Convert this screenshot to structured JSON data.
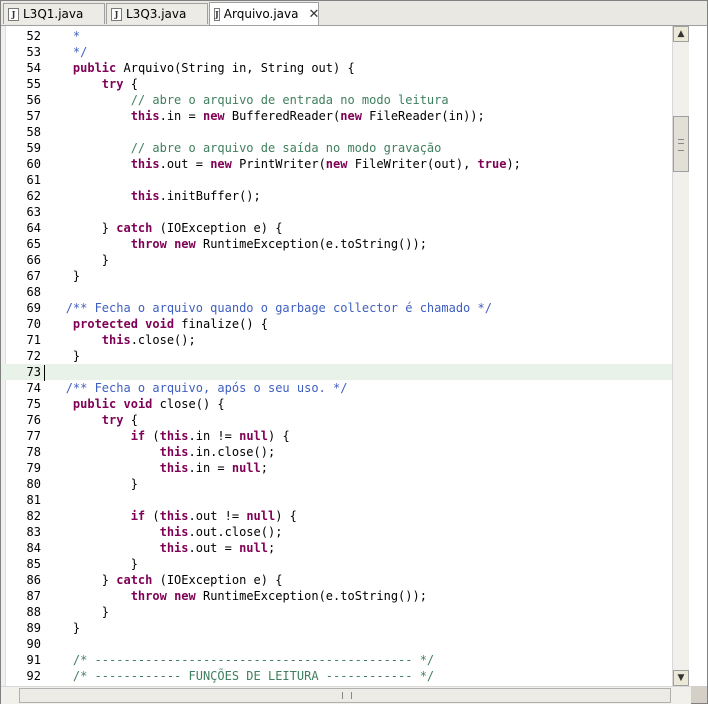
{
  "tabs": [
    {
      "label": "L3Q1.java",
      "active": false
    },
    {
      "label": "L3Q3.java",
      "active": false
    },
    {
      "label": "Arquivo.java",
      "active": true
    }
  ],
  "icons": {
    "file": "java-file-icon",
    "close": "close-icon",
    "up": "arrow-up-icon",
    "down": "arrow-down-icon"
  },
  "editor": {
    "current_line": 73,
    "lines": [
      {
        "n": "52",
        "segs": [
          {
            "t": "    ",
            "c": ""
          },
          {
            "t": "*",
            "c": "jd"
          }
        ]
      },
      {
        "n": "53",
        "segs": [
          {
            "t": "    ",
            "c": ""
          },
          {
            "t": "*/",
            "c": "jd"
          }
        ]
      },
      {
        "n": "54",
        "segs": [
          {
            "t": "    ",
            "c": ""
          },
          {
            "t": "public",
            "c": "kw"
          },
          {
            "t": " Arquivo(String in, String out) {",
            "c": ""
          }
        ]
      },
      {
        "n": "55",
        "segs": [
          {
            "t": "        ",
            "c": ""
          },
          {
            "t": "try",
            "c": "kw"
          },
          {
            "t": " {",
            "c": ""
          }
        ]
      },
      {
        "n": "56",
        "segs": [
          {
            "t": "            ",
            "c": ""
          },
          {
            "t": "// abre o arquivo de entrada no modo leitura",
            "c": "cm"
          }
        ]
      },
      {
        "n": "57",
        "segs": [
          {
            "t": "            ",
            "c": ""
          },
          {
            "t": "this",
            "c": "kw"
          },
          {
            "t": ".in = ",
            "c": ""
          },
          {
            "t": "new",
            "c": "kw"
          },
          {
            "t": " BufferedReader(",
            "c": ""
          },
          {
            "t": "new",
            "c": "kw"
          },
          {
            "t": " FileReader(in));",
            "c": ""
          }
        ]
      },
      {
        "n": "58",
        "segs": []
      },
      {
        "n": "59",
        "segs": [
          {
            "t": "            ",
            "c": ""
          },
          {
            "t": "// abre o arquivo de saída no modo gravação",
            "c": "cm"
          }
        ]
      },
      {
        "n": "60",
        "segs": [
          {
            "t": "            ",
            "c": ""
          },
          {
            "t": "this",
            "c": "kw"
          },
          {
            "t": ".out = ",
            "c": ""
          },
          {
            "t": "new",
            "c": "kw"
          },
          {
            "t": " PrintWriter(",
            "c": ""
          },
          {
            "t": "new",
            "c": "kw"
          },
          {
            "t": " FileWriter(out), ",
            "c": ""
          },
          {
            "t": "true",
            "c": "kw"
          },
          {
            "t": ");",
            "c": ""
          }
        ]
      },
      {
        "n": "61",
        "segs": []
      },
      {
        "n": "62",
        "segs": [
          {
            "t": "            ",
            "c": ""
          },
          {
            "t": "this",
            "c": "kw"
          },
          {
            "t": ".initBuffer();",
            "c": ""
          }
        ]
      },
      {
        "n": "63",
        "segs": []
      },
      {
        "n": "64",
        "segs": [
          {
            "t": "        } ",
            "c": ""
          },
          {
            "t": "catch",
            "c": "kw"
          },
          {
            "t": " (IOException e) {",
            "c": ""
          }
        ]
      },
      {
        "n": "65",
        "segs": [
          {
            "t": "            ",
            "c": ""
          },
          {
            "t": "throw",
            "c": "kw"
          },
          {
            "t": " ",
            "c": ""
          },
          {
            "t": "new",
            "c": "kw"
          },
          {
            "t": " RuntimeException(e.toString());",
            "c": ""
          }
        ]
      },
      {
        "n": "66",
        "segs": [
          {
            "t": "        }",
            "c": ""
          }
        ]
      },
      {
        "n": "67",
        "segs": [
          {
            "t": "    }",
            "c": ""
          }
        ]
      },
      {
        "n": "68",
        "segs": []
      },
      {
        "n": "69",
        "segs": [
          {
            "t": "   ",
            "c": ""
          },
          {
            "t": "/** Fecha o arquivo quando o garbage collector é chamado */",
            "c": "jd"
          }
        ]
      },
      {
        "n": "70",
        "segs": [
          {
            "t": "    ",
            "c": ""
          },
          {
            "t": "protected",
            "c": "kw"
          },
          {
            "t": " ",
            "c": ""
          },
          {
            "t": "void",
            "c": "kw"
          },
          {
            "t": " finalize() {",
            "c": ""
          }
        ]
      },
      {
        "n": "71",
        "segs": [
          {
            "t": "        ",
            "c": ""
          },
          {
            "t": "this",
            "c": "kw"
          },
          {
            "t": ".close();",
            "c": ""
          }
        ]
      },
      {
        "n": "72",
        "segs": [
          {
            "t": "    }",
            "c": ""
          }
        ]
      },
      {
        "n": "73",
        "segs": []
      },
      {
        "n": "74",
        "segs": [
          {
            "t": "   ",
            "c": ""
          },
          {
            "t": "/** Fecha o arquivo, após o seu uso. */",
            "c": "jd"
          }
        ]
      },
      {
        "n": "75",
        "segs": [
          {
            "t": "    ",
            "c": ""
          },
          {
            "t": "public",
            "c": "kw"
          },
          {
            "t": " ",
            "c": ""
          },
          {
            "t": "void",
            "c": "kw"
          },
          {
            "t": " close() {",
            "c": ""
          }
        ]
      },
      {
        "n": "76",
        "segs": [
          {
            "t": "        ",
            "c": ""
          },
          {
            "t": "try",
            "c": "kw"
          },
          {
            "t": " {",
            "c": ""
          }
        ]
      },
      {
        "n": "77",
        "segs": [
          {
            "t": "            ",
            "c": ""
          },
          {
            "t": "if",
            "c": "kw"
          },
          {
            "t": " (",
            "c": ""
          },
          {
            "t": "this",
            "c": "kw"
          },
          {
            "t": ".in != ",
            "c": ""
          },
          {
            "t": "null",
            "c": "kw"
          },
          {
            "t": ") {",
            "c": ""
          }
        ]
      },
      {
        "n": "78",
        "segs": [
          {
            "t": "                ",
            "c": ""
          },
          {
            "t": "this",
            "c": "kw"
          },
          {
            "t": ".in.close();",
            "c": ""
          }
        ]
      },
      {
        "n": "79",
        "segs": [
          {
            "t": "                ",
            "c": ""
          },
          {
            "t": "this",
            "c": "kw"
          },
          {
            "t": ".in = ",
            "c": ""
          },
          {
            "t": "null",
            "c": "kw"
          },
          {
            "t": ";",
            "c": ""
          }
        ]
      },
      {
        "n": "80",
        "segs": [
          {
            "t": "            }",
            "c": ""
          }
        ]
      },
      {
        "n": "81",
        "segs": []
      },
      {
        "n": "82",
        "segs": [
          {
            "t": "            ",
            "c": ""
          },
          {
            "t": "if",
            "c": "kw"
          },
          {
            "t": " (",
            "c": ""
          },
          {
            "t": "this",
            "c": "kw"
          },
          {
            "t": ".out != ",
            "c": ""
          },
          {
            "t": "null",
            "c": "kw"
          },
          {
            "t": ") {",
            "c": ""
          }
        ]
      },
      {
        "n": "83",
        "segs": [
          {
            "t": "                ",
            "c": ""
          },
          {
            "t": "this",
            "c": "kw"
          },
          {
            "t": ".out.close();",
            "c": ""
          }
        ]
      },
      {
        "n": "84",
        "segs": [
          {
            "t": "                ",
            "c": ""
          },
          {
            "t": "this",
            "c": "kw"
          },
          {
            "t": ".out = ",
            "c": ""
          },
          {
            "t": "null",
            "c": "kw"
          },
          {
            "t": ";",
            "c": ""
          }
        ]
      },
      {
        "n": "85",
        "segs": [
          {
            "t": "            }",
            "c": ""
          }
        ]
      },
      {
        "n": "86",
        "segs": [
          {
            "t": "        } ",
            "c": ""
          },
          {
            "t": "catch",
            "c": "kw"
          },
          {
            "t": " (IOException e) {",
            "c": ""
          }
        ]
      },
      {
        "n": "87",
        "segs": [
          {
            "t": "            ",
            "c": ""
          },
          {
            "t": "throw",
            "c": "kw"
          },
          {
            "t": " ",
            "c": ""
          },
          {
            "t": "new",
            "c": "kw"
          },
          {
            "t": " RuntimeException(e.toString());",
            "c": ""
          }
        ]
      },
      {
        "n": "88",
        "segs": [
          {
            "t": "        }",
            "c": ""
          }
        ]
      },
      {
        "n": "89",
        "segs": [
          {
            "t": "    }",
            "c": ""
          }
        ]
      },
      {
        "n": "90",
        "segs": []
      },
      {
        "n": "91",
        "segs": [
          {
            "t": "    ",
            "c": ""
          },
          {
            "t": "/* -------------------------------------------- */",
            "c": "cm"
          }
        ]
      },
      {
        "n": "92",
        "segs": [
          {
            "t": "    ",
            "c": ""
          },
          {
            "t": "/* ------------ FUNÇÕES DE LEITURA ------------ */",
            "c": "cm"
          }
        ]
      }
    ]
  },
  "colors": {
    "keyword": "#7f0055",
    "comment": "#3f7f5f",
    "javadoc": "#3f5fbf",
    "current_line": "#e8f2e8"
  }
}
